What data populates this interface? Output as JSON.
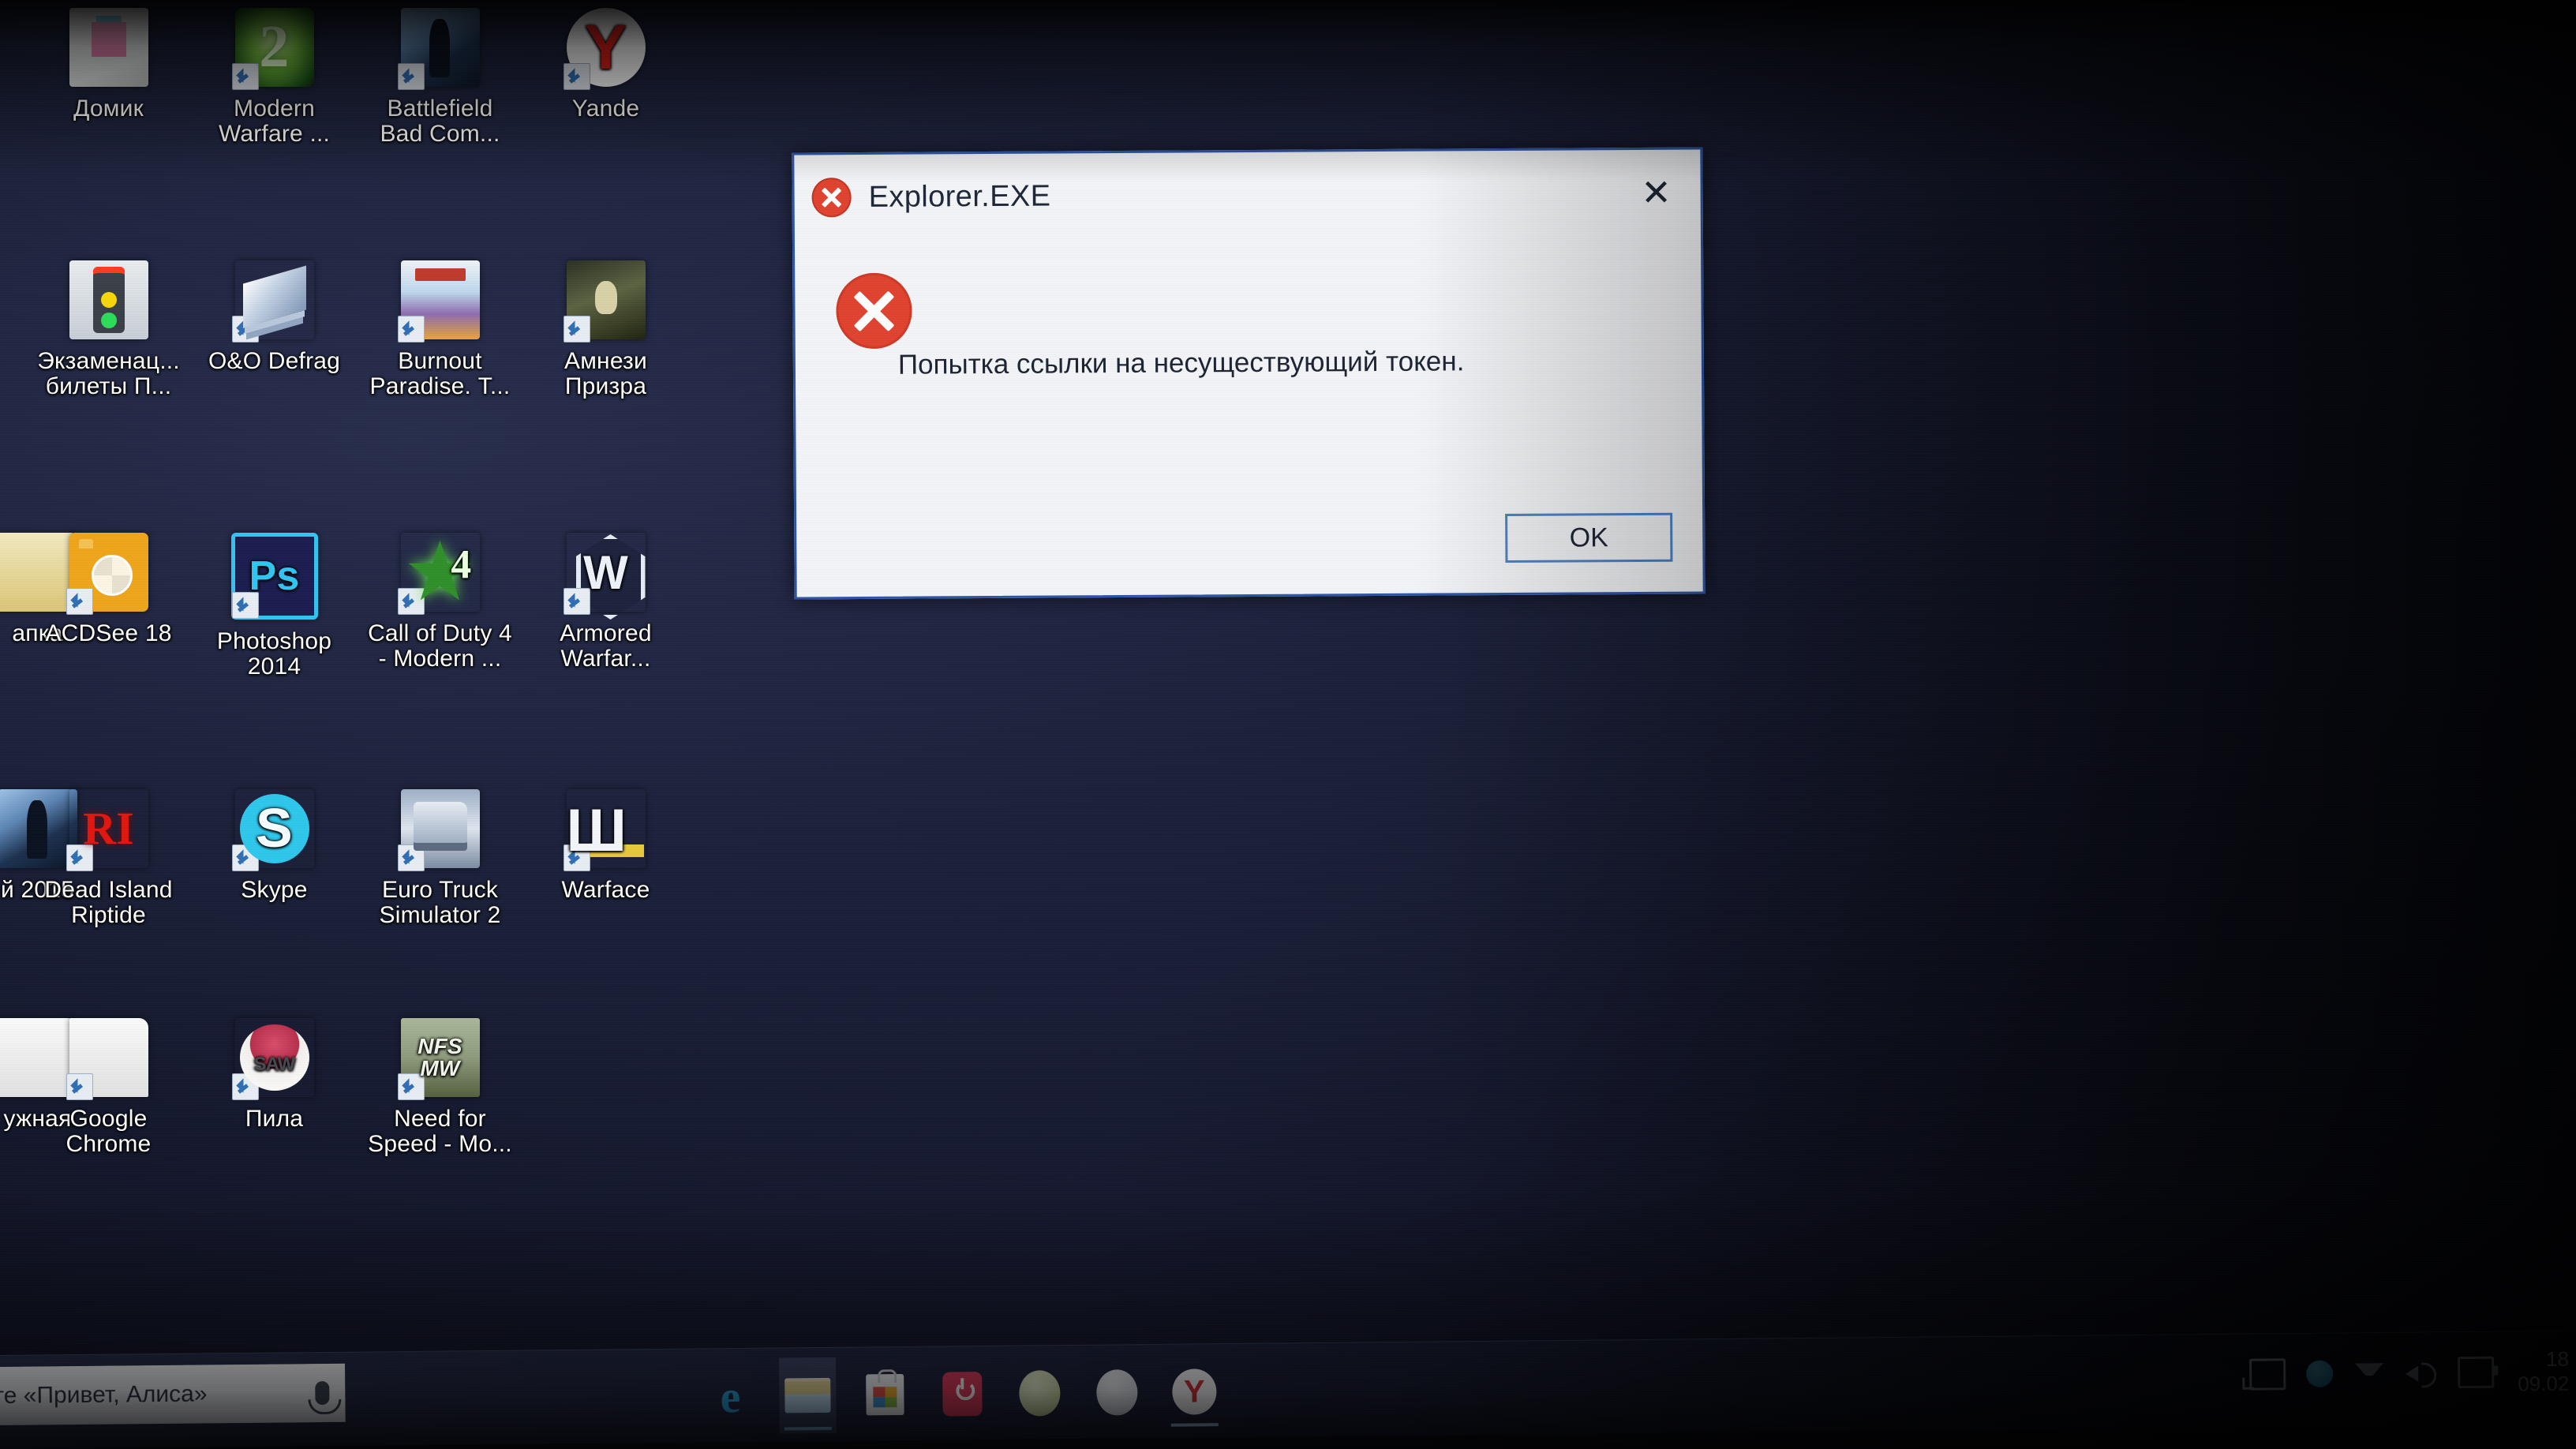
{
  "desktop": {
    "icons": [
      {
        "label": "Домик",
        "art": "art-domik",
        "shortcut": false,
        "col": 0,
        "row": 0
      },
      {
        "label": "Modern\nWarfare ...",
        "art": "art-mw2",
        "shortcut": true,
        "col": 1,
        "row": 0
      },
      {
        "label": "Battlefield\nBad Com...",
        "art": "art-bfbc",
        "shortcut": true,
        "col": 2,
        "row": 0
      },
      {
        "label": "Yande",
        "art": "art-yandex",
        "shortcut": true,
        "col": 3,
        "row": 0
      },
      {
        "label": "Экзаменац...\nбилеты П...",
        "art": "art-exam",
        "shortcut": false,
        "col": 0,
        "row": 1
      },
      {
        "label": "O&O Defrag",
        "art": "art-oodefrag",
        "shortcut": true,
        "col": 1,
        "row": 1
      },
      {
        "label": "Burnout\nParadise. Т...",
        "art": "art-burnout",
        "shortcut": true,
        "col": 2,
        "row": 1
      },
      {
        "label": "Амнези\nПризра",
        "art": "art-amnesia",
        "shortcut": true,
        "col": 3,
        "row": 1
      },
      {
        "label": "апка",
        "art": "art-folder",
        "shortcut": false,
        "col": -1,
        "row": 2
      },
      {
        "label": "ACDSee 18",
        "art": "art-acdsee",
        "shortcut": true,
        "col": 0,
        "row": 2
      },
      {
        "label": "Photoshop\n2014",
        "art": "art-ps",
        "shortcut": true,
        "col": 1,
        "row": 2
      },
      {
        "label": "Call of Duty 4\n- Modern ...",
        "art": "art-cod4",
        "shortcut": true,
        "col": 2,
        "row": 2
      },
      {
        "label": "Armored\nWarfar...",
        "art": "art-aw",
        "shortcut": true,
        "col": 3,
        "row": 2
      },
      {
        "label": "й 2015",
        "art": "art-bfbc",
        "shortcut": false,
        "col": -1,
        "row": 3
      },
      {
        "label": "Dead Island\nRiptide",
        "art": "art-deadisland",
        "shortcut": true,
        "col": 0,
        "row": 3
      },
      {
        "label": "Skype",
        "art": "art-skype",
        "shortcut": true,
        "col": 1,
        "row": 3
      },
      {
        "label": "Euro Truck\nSimulator 2",
        "art": "art-ets2",
        "shortcut": true,
        "col": 2,
        "row": 3
      },
      {
        "label": "Warface",
        "art": "art-warface",
        "shortcut": true,
        "col": 3,
        "row": 3
      },
      {
        "label": "ужная",
        "art": "art-paper",
        "shortcut": false,
        "col": -1,
        "row": 4
      },
      {
        "label": "Google\nChrome",
        "art": "art-paper",
        "shortcut": true,
        "col": 0,
        "row": 4
      },
      {
        "label": "Пила",
        "art": "art-pila",
        "shortcut": true,
        "col": 1,
        "row": 4
      },
      {
        "label": "Need for\nSpeed - Mo...",
        "art": "art-nfs",
        "shortcut": true,
        "col": 2,
        "row": 4
      }
    ]
  },
  "dialog": {
    "title": "Explorer.EXE",
    "title_icon": "error-circle-x-icon",
    "close_glyph": "✕",
    "body_icon": "error-circle-x-icon",
    "message": "Попытка ссылки на несуществующий токен.",
    "ok_label": "OK",
    "accent_border": "#2c55a8",
    "error_red": "#e0432f",
    "ok_border": "#4a83c8"
  },
  "taskbar": {
    "search": {
      "placeholder": "те «Привет, Алиса»",
      "mic_icon": "microphone-icon"
    },
    "apps": [
      {
        "name": "microsoft-edge",
        "glyph_class": "gl-edge",
        "glyph": "e",
        "state": ""
      },
      {
        "name": "file-explorer",
        "glyph_class": "gl-explorer",
        "glyph": "",
        "state": "active"
      },
      {
        "name": "microsoft-store",
        "glyph_class": "gl-store",
        "glyph": "",
        "state": ""
      },
      {
        "name": "power-app",
        "glyph_class": "gl-power",
        "glyph": "",
        "state": ""
      },
      {
        "name": "green-circle-app",
        "glyph_class": "gl-circle-green",
        "glyph": "",
        "state": ""
      },
      {
        "name": "white-circle-app",
        "glyph_class": "gl-circle-white",
        "glyph": "",
        "state": ""
      },
      {
        "name": "yandex-browser",
        "glyph_class": "gl-yandex",
        "glyph": "",
        "state": "underline"
      }
    ],
    "tray": [
      {
        "name": "network-icon",
        "class": "ti-network"
      },
      {
        "name": "onedrive-icon",
        "class": "ti-onedrive"
      },
      {
        "name": "updown-icon",
        "class": "ti-updown"
      },
      {
        "name": "volume-icon",
        "class": "ti-volume"
      },
      {
        "name": "battery-icon",
        "class": "ti-battery"
      }
    ],
    "clock": {
      "time": "18",
      "date": "09.02"
    }
  }
}
